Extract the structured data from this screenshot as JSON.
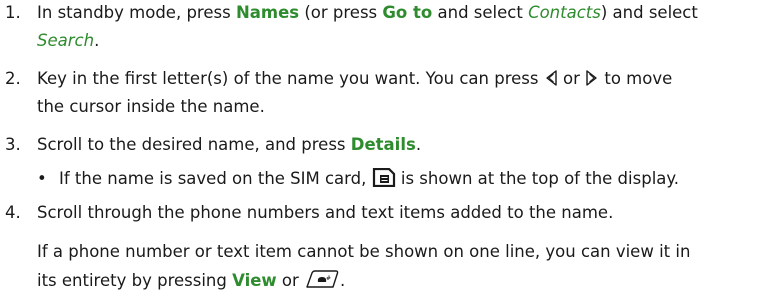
{
  "steps": [
    {
      "number": "1.",
      "line1": {
        "t1": "In standby mode, press ",
        "k1": "Names",
        "t2": " (or press ",
        "k2": "Go to",
        "t3": " and select ",
        "i1": "Contacts",
        "t4": ") and select"
      },
      "line2": {
        "i1": "Search",
        "t1": "."
      }
    },
    {
      "number": "2.",
      "line1": {
        "t1": "Key in the first letter(s) of the name you want. You can press ",
        "t2": " or ",
        "t3": " to move"
      },
      "line2": {
        "t1": "the cursor inside the name."
      }
    },
    {
      "number": "3.",
      "line1": {
        "t1": "Scroll to the desired name, and press ",
        "k1": "Details",
        "t2": "."
      },
      "bullet": {
        "t1": "If the name is saved on the SIM card, ",
        "t2": " is shown at the top of the display."
      }
    },
    {
      "number": "4.",
      "line1": {
        "t1": "Scroll through the phone numbers and text items added to the name."
      },
      "note": {
        "line1": "If a phone number or text item cannot be shown on one line, you can view it in",
        "line2": {
          "t1": "its entirety by pressing ",
          "k1": "View",
          "t2": " or ",
          "t3": "."
        }
      }
    }
  ],
  "icons": {
    "left_key": "scroll-left-key-icon",
    "right_key": "scroll-right-key-icon",
    "sim_card": "sim-card-icon",
    "call_key": "call-key-icon"
  },
  "colors": {
    "keyword": "#2e8b2e",
    "text": "#1a1a1a"
  }
}
